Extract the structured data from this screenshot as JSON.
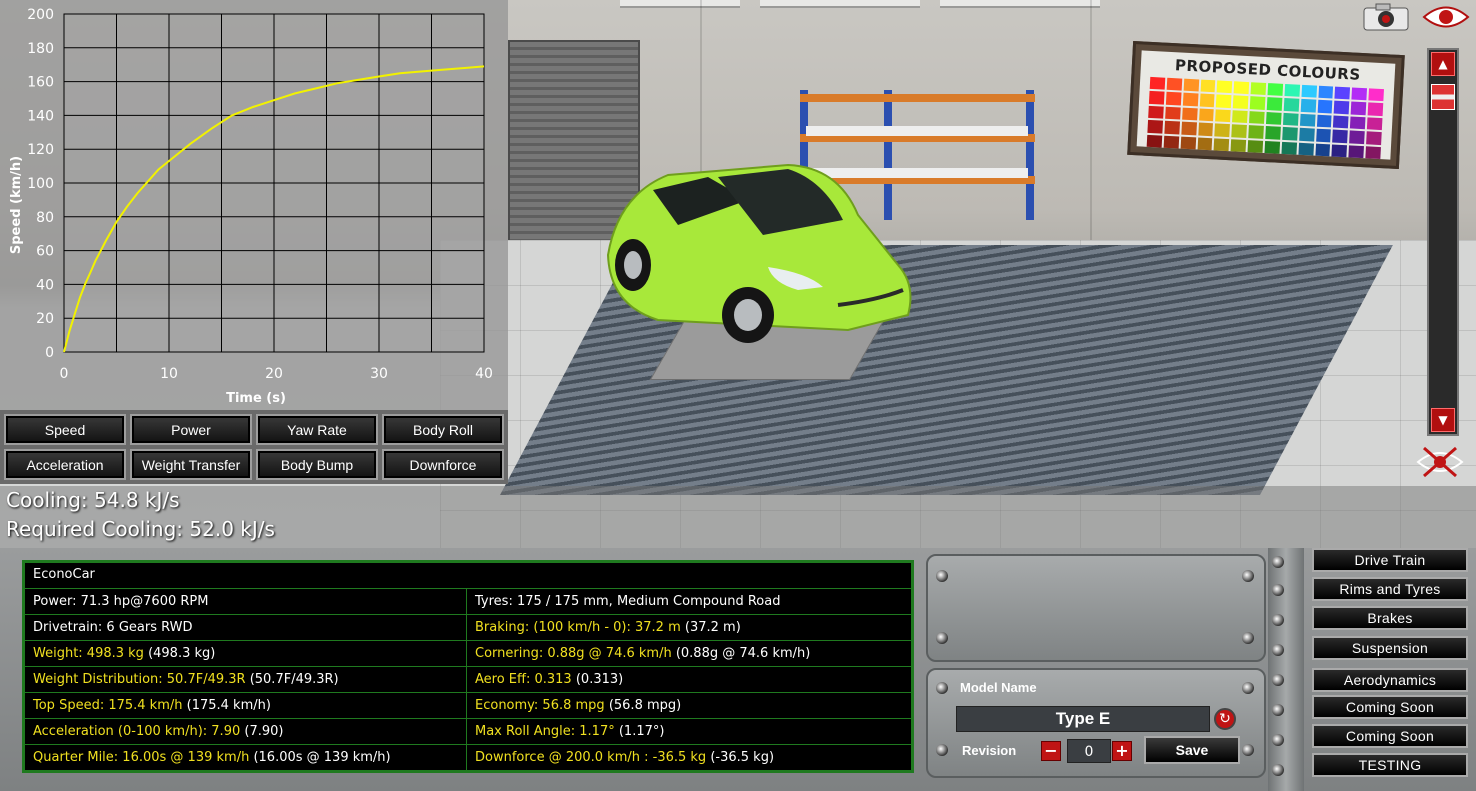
{
  "graph": {
    "chart_data": {
      "type": "line",
      "xlabel": "Time (s)",
      "ylabel": "Speed (km/h)",
      "xlim": [
        0,
        40
      ],
      "ylim": [
        0,
        200
      ],
      "x_ticks": [
        "0",
        "10",
        "20",
        "30",
        "40"
      ],
      "y_ticks": [
        "0",
        "20",
        "40",
        "60",
        "80",
        "100",
        "120",
        "140",
        "160",
        "180",
        "200"
      ],
      "grid": true,
      "color": "#f2f200",
      "x": [
        0,
        0.5,
        1,
        1.5,
        2,
        2.5,
        3,
        3.5,
        4,
        5,
        6,
        7,
        8,
        9,
        10,
        12,
        14,
        16,
        18,
        20,
        22,
        24,
        26,
        28,
        30,
        32,
        34,
        36,
        38,
        40
      ],
      "y": [
        0,
        12,
        22,
        32,
        40,
        47,
        54,
        60,
        66,
        77,
        86,
        94,
        101,
        108,
        113,
        123,
        132,
        140,
        145,
        149,
        153,
        156,
        159,
        161,
        163,
        165,
        166,
        167,
        168,
        169
      ]
    },
    "buttons": [
      "Speed",
      "Power",
      "Yaw Rate",
      "Body Roll",
      "Acceleration",
      "Weight Transfer",
      "Body Bump",
      "Downforce"
    ]
  },
  "colour_board": {
    "title": "PROPOSED COLOURS",
    "colors": [
      "#c81a1a",
      "#d83a1a",
      "#e86a1a",
      "#f0a01a",
      "#f0d01a",
      "#c8e01a",
      "#80d01a",
      "#30c030",
      "#20b080",
      "#2090c0",
      "#2060d0",
      "#4030c0",
      "#8020b0",
      "#c02090"
    ]
  },
  "cooling": {
    "cooling": "Cooling: 54.8 kJ/s",
    "required": "Required Cooling: 52.0 kJ/s"
  },
  "stats": {
    "title": "EconoCar",
    "rows": [
      [
        {
          "text": "Power: 71.3 hp@7600 RPM",
          "extra": ""
        },
        {
          "text": "Tyres: 175 / 175 mm, Medium Compound Road",
          "extra": ""
        }
      ],
      [
        {
          "text": "Drivetrain: 6 Gears RWD",
          "extra": ""
        },
        {
          "text": "Braking: (100 km/h - 0): 37.2 m",
          "extra": " (37.2 m)"
        }
      ],
      [
        {
          "text": "Weight: 498.3 kg",
          "extra": " (498.3 kg)"
        },
        {
          "text": "Cornering: 0.88g @ 74.6 km/h",
          "extra": " (0.88g @ 74.6 km/h)"
        }
      ],
      [
        {
          "text": "Weight Distribution: 50.7F/49.3R",
          "extra": " (50.7F/49.3R)"
        },
        {
          "text": "Aero Eff: 0.313",
          "extra": " (0.313)"
        }
      ],
      [
        {
          "text": "Top Speed: 175.4 km/h",
          "extra": " (175.4 km/h)"
        },
        {
          "text": "Economy: 56.8 mpg",
          "extra": " (56.8 mpg)"
        }
      ],
      [
        {
          "text": "Acceleration (0-100 km/h): 7.90",
          "extra": " (7.90)"
        },
        {
          "text": "Max Roll Angle: 1.17°",
          "extra": " (1.17°)"
        }
      ],
      [
        {
          "text": "Quarter Mile: 16.00s @ 139 km/h",
          "extra": " (16.00s @ 139 km/h)"
        },
        {
          "text": "Downforce @ 200.0 km/h : -36.5 kg",
          "extra": " (-36.5 kg)"
        }
      ]
    ]
  },
  "model": {
    "model_name_label": "Model Name",
    "model_name": "Type E",
    "revision_label": "Revision",
    "revision": "0",
    "minus": "−",
    "plus": "+",
    "save": "Save"
  },
  "menu": [
    "Drive Train",
    "Rims and Tyres",
    "Brakes",
    "Suspension",
    "Aerodynamics",
    "Coming Soon",
    "Coming Soon",
    "TESTING"
  ],
  "icons": {
    "camera": "camera-icon",
    "eye": "eye-icon",
    "hide": "hide-ui-icon"
  },
  "colors": {
    "accent_red": "#c01414",
    "stat_yellow": "#f0e020",
    "stat_border": "#1f7a1f",
    "car_green": "#a8e83a"
  }
}
